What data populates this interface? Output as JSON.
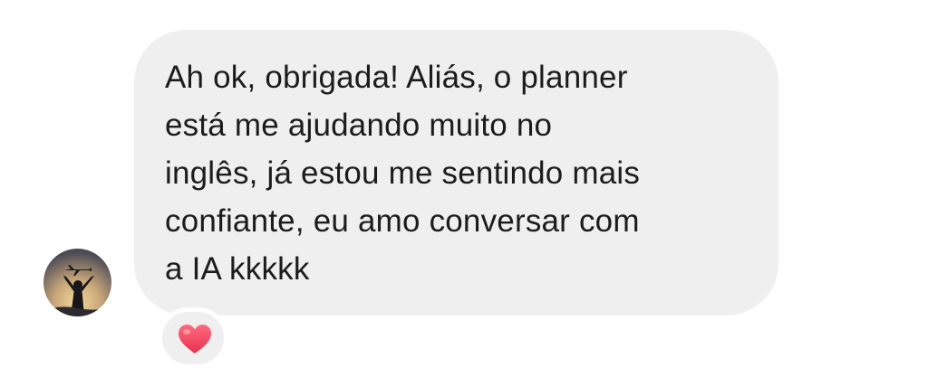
{
  "conversation": {
    "avatar_icon": "silhouette-airplane-sunset-icon",
    "message": {
      "lines": [
        "Ah ok, obrigada! Aliás, o planner",
        "está me ajudando muito no",
        "inglês, já estou me sentindo mais",
        "confiante, eu amo conversar com",
        "a IA kkkkk"
      ]
    },
    "reaction": {
      "icon": "red-heart-icon",
      "color": "#f0435f"
    },
    "colors": {
      "bubble": "#efefef",
      "text": "#1c1c1c",
      "background": "#ffffff"
    }
  }
}
